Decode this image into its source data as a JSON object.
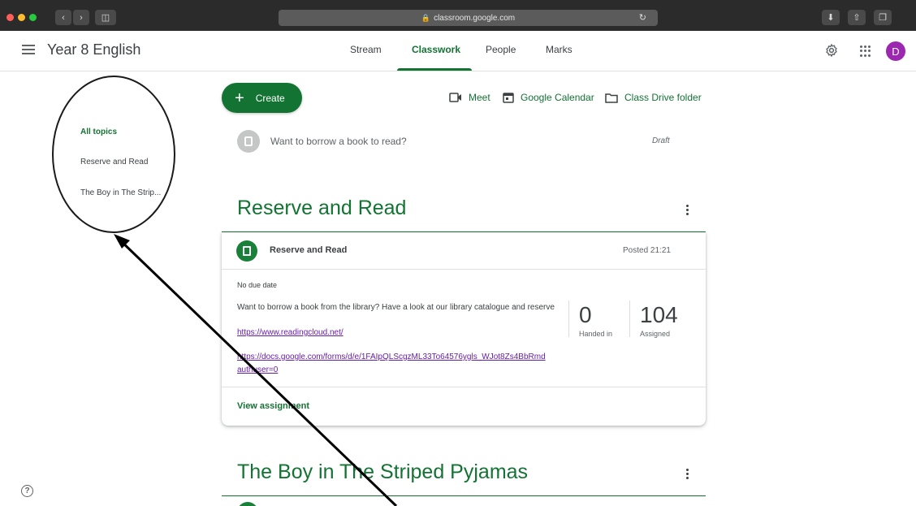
{
  "browser": {
    "url": "classroom.google.com",
    "lock_icon": "lock-icon",
    "traffic_light_colors": [
      "#ff5f57",
      "#febc2e",
      "#28c840"
    ]
  },
  "header": {
    "class_name": "Year 8 English",
    "tabs": [
      {
        "label": "Stream"
      },
      {
        "label": "Classwork"
      },
      {
        "label": "People"
      },
      {
        "label": "Marks"
      }
    ],
    "active_tab": "Classwork",
    "avatar_letter": "D",
    "avatar_color": "#9c27b0"
  },
  "topics": {
    "items": [
      {
        "label": "All topics"
      },
      {
        "label": "Reserve and Read"
      },
      {
        "label": "The Boy in The Strip..."
      }
    ],
    "active": "All topics"
  },
  "toolbar": {
    "create_label": "Create",
    "meet_label": "Meet",
    "calendar_label": "Google Calendar",
    "drive_label": "Class Drive folder"
  },
  "draft": {
    "title": "Want to borrow a book to read?",
    "status": "Draft"
  },
  "sections": [
    {
      "title": "Reserve and Read",
      "assignment": {
        "title": "Reserve and Read",
        "posted": "Posted 21:21",
        "due": "No due date",
        "description": "Want to borrow a book from the library? Have a look at our library catalogue and reserve",
        "link1": "https://www.readingcloud.net/",
        "link2_line1": "https://docs.google.com/forms/d/e/1FAIpQLScgzML33To64576ygls_WJot8Zs4BbRmd",
        "link2_line2": "authuser=0",
        "handed_in_count": "0",
        "handed_in_label": "Handed in",
        "assigned_count": "104",
        "assigned_label": "Assigned",
        "view_label": "View assignment"
      }
    },
    {
      "title": "The Boy in The Striped Pyjamas"
    }
  ],
  "colors": {
    "accent": "#137333",
    "link_visited": "#681da8"
  }
}
